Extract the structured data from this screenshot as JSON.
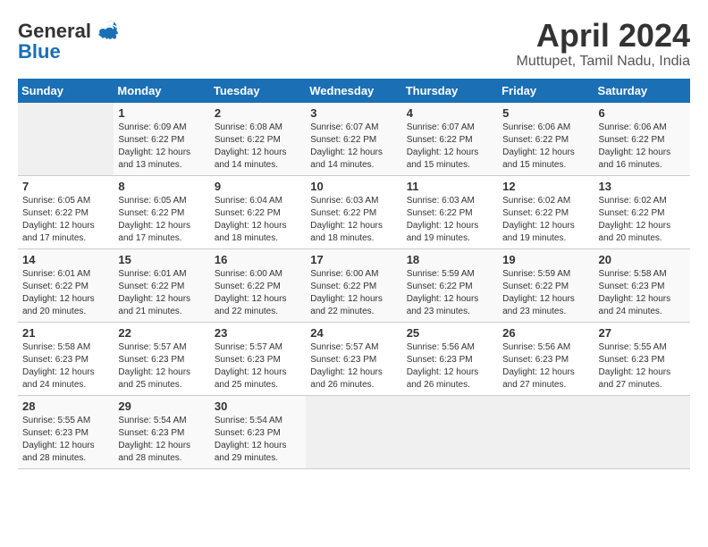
{
  "header": {
    "logo_line1": "General",
    "logo_line2": "Blue",
    "month_title": "April 2024",
    "location": "Muttupet, Tamil Nadu, India"
  },
  "calendar": {
    "days_of_week": [
      "Sunday",
      "Monday",
      "Tuesday",
      "Wednesday",
      "Thursday",
      "Friday",
      "Saturday"
    ],
    "weeks": [
      [
        {
          "day": "",
          "info": ""
        },
        {
          "day": "1",
          "info": "Sunrise: 6:09 AM\nSunset: 6:22 PM\nDaylight: 12 hours\nand 13 minutes."
        },
        {
          "day": "2",
          "info": "Sunrise: 6:08 AM\nSunset: 6:22 PM\nDaylight: 12 hours\nand 14 minutes."
        },
        {
          "day": "3",
          "info": "Sunrise: 6:07 AM\nSunset: 6:22 PM\nDaylight: 12 hours\nand 14 minutes."
        },
        {
          "day": "4",
          "info": "Sunrise: 6:07 AM\nSunset: 6:22 PM\nDaylight: 12 hours\nand 15 minutes."
        },
        {
          "day": "5",
          "info": "Sunrise: 6:06 AM\nSunset: 6:22 PM\nDaylight: 12 hours\nand 15 minutes."
        },
        {
          "day": "6",
          "info": "Sunrise: 6:06 AM\nSunset: 6:22 PM\nDaylight: 12 hours\nand 16 minutes."
        }
      ],
      [
        {
          "day": "7",
          "info": "Sunrise: 6:05 AM\nSunset: 6:22 PM\nDaylight: 12 hours\nand 17 minutes."
        },
        {
          "day": "8",
          "info": "Sunrise: 6:05 AM\nSunset: 6:22 PM\nDaylight: 12 hours\nand 17 minutes."
        },
        {
          "day": "9",
          "info": "Sunrise: 6:04 AM\nSunset: 6:22 PM\nDaylight: 12 hours\nand 18 minutes."
        },
        {
          "day": "10",
          "info": "Sunrise: 6:03 AM\nSunset: 6:22 PM\nDaylight: 12 hours\nand 18 minutes."
        },
        {
          "day": "11",
          "info": "Sunrise: 6:03 AM\nSunset: 6:22 PM\nDaylight: 12 hours\nand 19 minutes."
        },
        {
          "day": "12",
          "info": "Sunrise: 6:02 AM\nSunset: 6:22 PM\nDaylight: 12 hours\nand 19 minutes."
        },
        {
          "day": "13",
          "info": "Sunrise: 6:02 AM\nSunset: 6:22 PM\nDaylight: 12 hours\nand 20 minutes."
        }
      ],
      [
        {
          "day": "14",
          "info": "Sunrise: 6:01 AM\nSunset: 6:22 PM\nDaylight: 12 hours\nand 20 minutes."
        },
        {
          "day": "15",
          "info": "Sunrise: 6:01 AM\nSunset: 6:22 PM\nDaylight: 12 hours\nand 21 minutes."
        },
        {
          "day": "16",
          "info": "Sunrise: 6:00 AM\nSunset: 6:22 PM\nDaylight: 12 hours\nand 22 minutes."
        },
        {
          "day": "17",
          "info": "Sunrise: 6:00 AM\nSunset: 6:22 PM\nDaylight: 12 hours\nand 22 minutes."
        },
        {
          "day": "18",
          "info": "Sunrise: 5:59 AM\nSunset: 6:22 PM\nDaylight: 12 hours\nand 23 minutes."
        },
        {
          "day": "19",
          "info": "Sunrise: 5:59 AM\nSunset: 6:22 PM\nDaylight: 12 hours\nand 23 minutes."
        },
        {
          "day": "20",
          "info": "Sunrise: 5:58 AM\nSunset: 6:23 PM\nDaylight: 12 hours\nand 24 minutes."
        }
      ],
      [
        {
          "day": "21",
          "info": "Sunrise: 5:58 AM\nSunset: 6:23 PM\nDaylight: 12 hours\nand 24 minutes."
        },
        {
          "day": "22",
          "info": "Sunrise: 5:57 AM\nSunset: 6:23 PM\nDaylight: 12 hours\nand 25 minutes."
        },
        {
          "day": "23",
          "info": "Sunrise: 5:57 AM\nSunset: 6:23 PM\nDaylight: 12 hours\nand 25 minutes."
        },
        {
          "day": "24",
          "info": "Sunrise: 5:57 AM\nSunset: 6:23 PM\nDaylight: 12 hours\nand 26 minutes."
        },
        {
          "day": "25",
          "info": "Sunrise: 5:56 AM\nSunset: 6:23 PM\nDaylight: 12 hours\nand 26 minutes."
        },
        {
          "day": "26",
          "info": "Sunrise: 5:56 AM\nSunset: 6:23 PM\nDaylight: 12 hours\nand 27 minutes."
        },
        {
          "day": "27",
          "info": "Sunrise: 5:55 AM\nSunset: 6:23 PM\nDaylight: 12 hours\nand 27 minutes."
        }
      ],
      [
        {
          "day": "28",
          "info": "Sunrise: 5:55 AM\nSunset: 6:23 PM\nDaylight: 12 hours\nand 28 minutes."
        },
        {
          "day": "29",
          "info": "Sunrise: 5:54 AM\nSunset: 6:23 PM\nDaylight: 12 hours\nand 28 minutes."
        },
        {
          "day": "30",
          "info": "Sunrise: 5:54 AM\nSunset: 6:23 PM\nDaylight: 12 hours\nand 29 minutes."
        },
        {
          "day": "",
          "info": ""
        },
        {
          "day": "",
          "info": ""
        },
        {
          "day": "",
          "info": ""
        },
        {
          "day": "",
          "info": ""
        }
      ]
    ]
  }
}
